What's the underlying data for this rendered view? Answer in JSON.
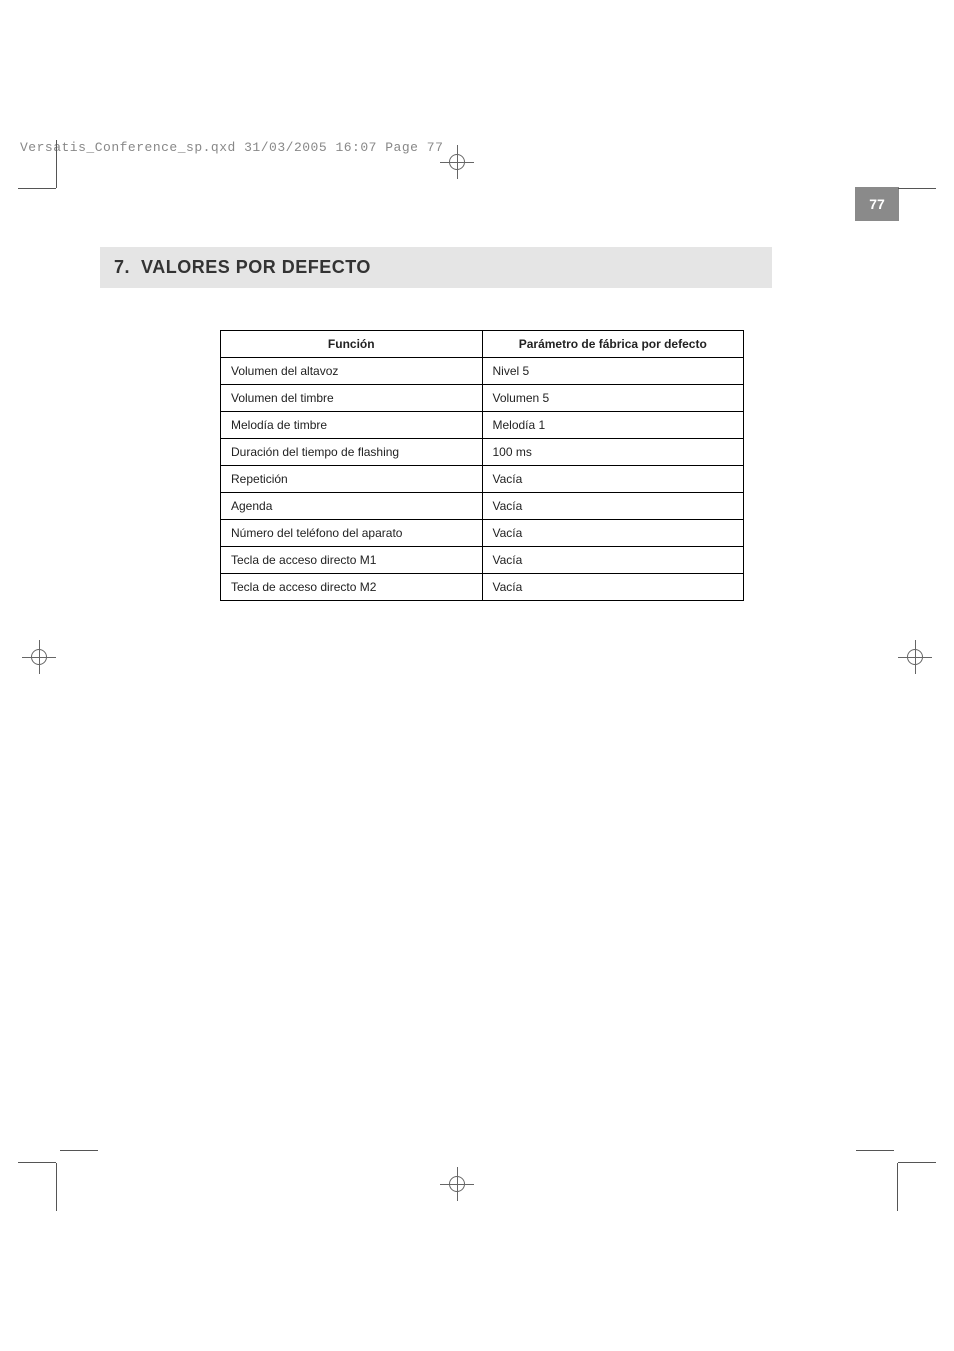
{
  "slug": "Versatis_Conference_sp.qxd  31/03/2005  16:07  Page 77",
  "page_number": "77",
  "section": {
    "number": "7.",
    "title": "VALORES POR DEFECTO"
  },
  "table": {
    "headers": {
      "function": "Función",
      "default": "Parámetro de fábrica por defecto"
    },
    "rows": [
      {
        "function": "Volumen del altavoz",
        "default": "Nivel 5"
      },
      {
        "function": "Volumen del timbre",
        "default": "Volumen 5"
      },
      {
        "function": "Melodía de timbre",
        "default": "Melodía 1"
      },
      {
        "function": "Duración del tiempo de flashing",
        "default": "100 ms"
      },
      {
        "function": "Repetición",
        "default": "Vacía"
      },
      {
        "function": "Agenda",
        "default": "Vacía"
      },
      {
        "function": "Número del teléfono del aparato",
        "default": "Vacía"
      },
      {
        "function": "Tecla de acceso directo M1",
        "default": "Vacía"
      },
      {
        "function": "Tecla de acceso directo M2",
        "default": "Vacía"
      }
    ]
  }
}
